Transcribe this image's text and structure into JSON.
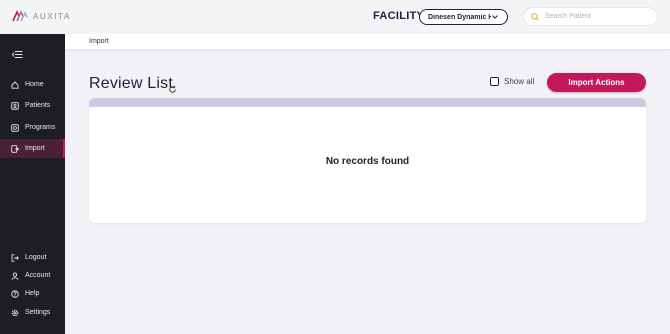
{
  "app": {
    "logo_text": "AUXITA"
  },
  "header": {
    "facility_label": "FACILITY",
    "facility_value": "Dinesen Dynamic H...",
    "search_placeholder": "Search Patient"
  },
  "sidebar": {
    "items": [
      {
        "label": "Home",
        "icon": "home-icon"
      },
      {
        "label": "Patients",
        "icon": "patients-icon"
      },
      {
        "label": "Programs",
        "icon": "programs-icon"
      },
      {
        "label": "Import",
        "icon": "import-icon",
        "active": true
      }
    ],
    "bottom_items": [
      {
        "label": "Logout",
        "icon": "logout-icon"
      },
      {
        "label": "Account",
        "icon": "account-icon"
      },
      {
        "label": "Help",
        "icon": "help-icon"
      },
      {
        "label": "Settings",
        "icon": "settings-icon"
      }
    ]
  },
  "breadcrumb": {
    "current": "Import"
  },
  "main": {
    "title": "Review List",
    "show_all_label": "Show all",
    "show_all_checked": false,
    "import_actions_label": "Import Actions",
    "empty_message": "No records found"
  },
  "colors": {
    "accent": "#c3185b",
    "sidebar_bg": "#1e1d22",
    "title": "#2b1a3c",
    "card_header": "#cec8e2"
  }
}
